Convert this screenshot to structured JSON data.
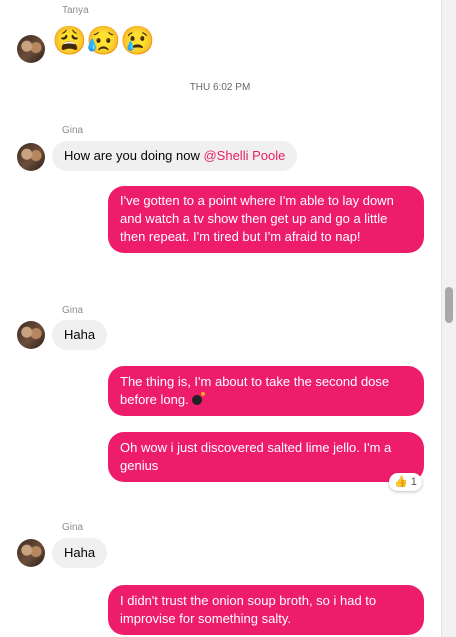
{
  "messages": {
    "tanya": {
      "sender": "Tanya",
      "emojis": [
        "😩",
        "😥",
        "😢"
      ]
    },
    "timestamp": "THU 6:02 PM",
    "gina1": {
      "sender": "Gina",
      "text": "How are you doing now",
      "mention": "@Shelli Poole"
    },
    "out1": "I've gotten to a point where I'm able to lay down and watch a tv show then get up and go a little then repeat. I'm tired but I'm afraid to nap!",
    "gina2": {
      "sender": "Gina",
      "text": "Haha"
    },
    "out2": "The thing is, I'm about to take the second dose before long.",
    "out3": "Oh wow i just discovered salted lime jello. I'm a genius",
    "out3_reaction": {
      "emoji": "👍",
      "count": "1"
    },
    "gina3": {
      "sender": "Gina",
      "text": "Haha"
    },
    "out4": "I didn't trust the onion soup broth, so i had to improvise for something salty."
  },
  "colors": {
    "outgoing": "#ee1d6b",
    "incoming": "#f0f0f0",
    "mention": "#e91e63"
  },
  "icons": {
    "avatar": "avatar-photo",
    "bomb": "bomb-emoji"
  }
}
